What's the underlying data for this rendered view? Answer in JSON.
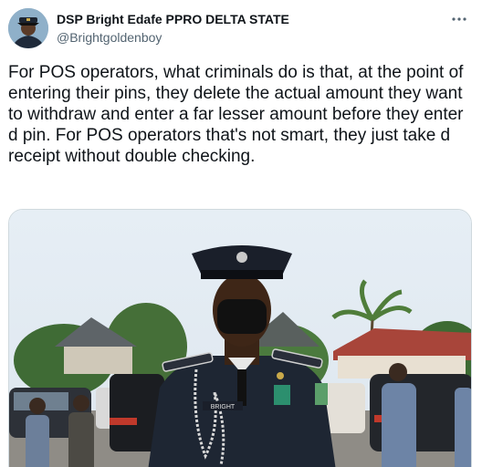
{
  "author": {
    "display_name": "DSP Bright Edafe PPRO DELTA STATE",
    "handle": "@Brightgoldenboy"
  },
  "tweet": {
    "text": "For POS operators, what criminals do is that, at the point of entering their pins, they delete the actual amount they want to withdraw and enter a far lesser amount before they enter d pin. For POS operators that's not smart, they just take d receipt without double checking."
  },
  "media": {
    "name_tag": "BRIGHT"
  },
  "icons": {
    "more": "more-icon"
  },
  "colors": {
    "text": "#0f1419",
    "secondary": "#536471",
    "border": "#cfd9de"
  }
}
